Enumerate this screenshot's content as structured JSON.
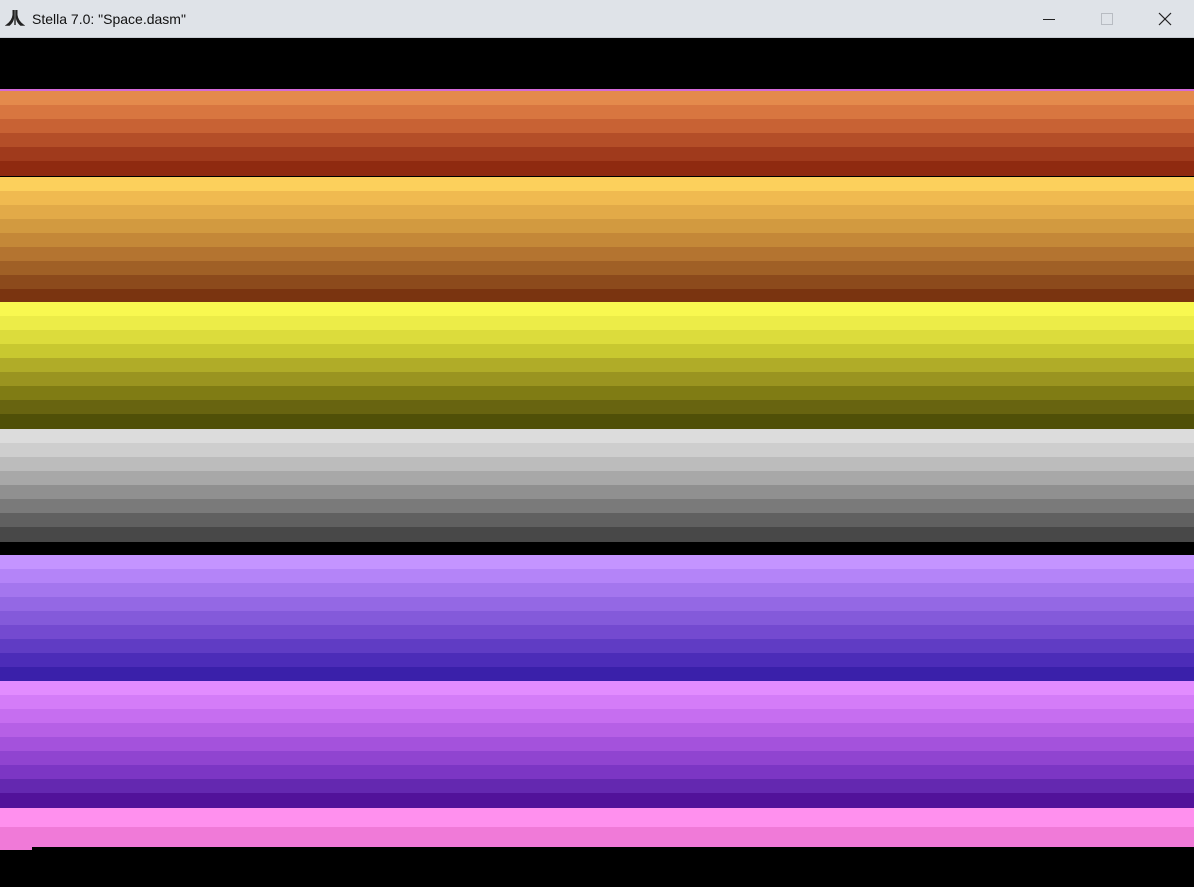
{
  "window": {
    "title": "Stella 7.0: \"Space.dasm\"",
    "icons": {
      "app": "atari-logo-icon",
      "minimize": "minimize-icon",
      "maximize": "maximize-icon",
      "close": "close-icon"
    }
  },
  "screen": {
    "background": "#000000",
    "bands": [
      {
        "name": "orange-red",
        "colors": [
          "#e48a4c",
          "#d87640",
          "#c86234",
          "#b44e28",
          "#a03a1c",
          "#8f2a10"
        ]
      },
      {
        "name": "amber",
        "colors": [
          "#fcd05c",
          "#f0ba50",
          "#e2aa48",
          "#d29a40",
          "#c48838",
          "#b47430",
          "#a06026",
          "#8c4a1c",
          "#7a3410"
        ]
      },
      {
        "name": "yellow",
        "colors": [
          "#f8f850",
          "#ecec48",
          "#dcdc3c",
          "#c8c830",
          "#b0ac28",
          "#9a9420",
          "#807c14",
          "#686410",
          "#505008"
        ]
      },
      {
        "name": "gray",
        "colors": [
          "#dcdcdc",
          "#cecece",
          "#bcbcbc",
          "#a8a8a8",
          "#909090",
          "#7a7a7a",
          "#606060",
          "#484848"
        ]
      },
      {
        "name": "violet",
        "colors": [
          "#c494ff",
          "#b484f8",
          "#a476ee",
          "#9468e4",
          "#845ada",
          "#744ad0",
          "#603cc4",
          "#4c2cb8",
          "#3a20aa",
          "#24129c"
        ]
      },
      {
        "name": "magenta",
        "colors": [
          "#e28cff",
          "#d47cf8",
          "#c66ef0",
          "#b660e6",
          "#a452dc",
          "#9044d0",
          "#7c36c4",
          "#6428b0",
          "#52129a"
        ]
      },
      {
        "name": "pink",
        "colors": [
          "#ff90ee",
          "#f07ad8"
        ]
      }
    ]
  }
}
